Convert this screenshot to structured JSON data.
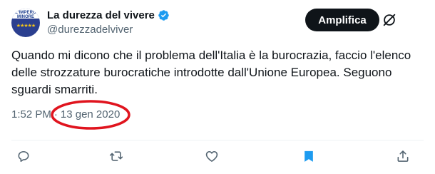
{
  "author": {
    "display_name": "La durezza del vivere",
    "handle": "@durezzadelviver",
    "avatar_line1": "L'IMPERO",
    "avatar_line2": "MINORE"
  },
  "header": {
    "amplify_label": "Amplifica"
  },
  "tweet": {
    "text": "Quando mi dicono che il problema dell'Italia è la burocrazia, faccio l'elenco delle strozzature burocratiche introdotte dall'Unione Europea. Seguono sguardi smarriti.",
    "time": "1:52 PM",
    "separator": "·",
    "date": "13 gen 2020"
  },
  "colors": {
    "accent": "#1d9bf0",
    "annotation": "#e0141e",
    "bookmark": "#1d9bf0",
    "muted": "#536471"
  },
  "actions": [
    {
      "name": "reply",
      "icon": "reply-icon"
    },
    {
      "name": "retweet",
      "icon": "retweet-icon"
    },
    {
      "name": "like",
      "icon": "heart-icon"
    },
    {
      "name": "bookmark",
      "icon": "bookmark-icon"
    },
    {
      "name": "share",
      "icon": "share-icon"
    }
  ]
}
